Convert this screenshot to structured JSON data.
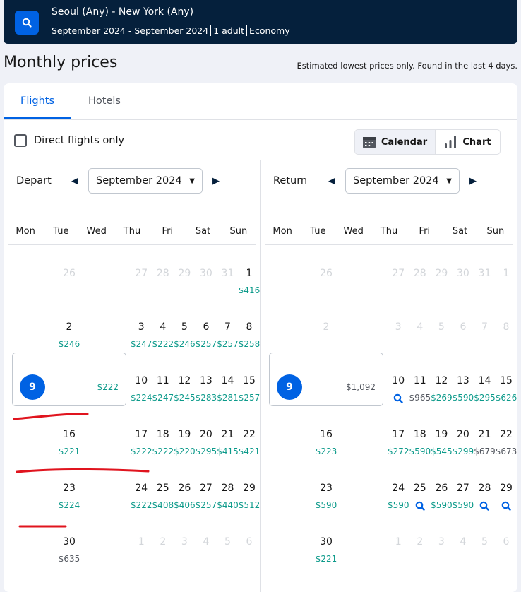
{
  "header": {
    "route": "Seoul (Any) - New York (Any)",
    "dates": "September 2024 - September 2024",
    "travellers": "1 adult",
    "cabin": "Economy"
  },
  "title": "Monthly prices",
  "note": "Estimated lowest prices only. Found in the last 4 days.",
  "tabs": [
    {
      "label": "Flights",
      "active": true
    },
    {
      "label": "Hotels",
      "active": false
    }
  ],
  "direct_label": "Direct flights only",
  "direct_checked": false,
  "view": {
    "calendar": "Calendar",
    "chart": "Chart",
    "active": "Calendar"
  },
  "weekdays": [
    "Mon",
    "Tue",
    "Wed",
    "Thu",
    "Fri",
    "Sat",
    "Sun"
  ],
  "colors": {
    "accent": "#0062e3",
    "header": "#05203c",
    "cheap": "#0c9a8a",
    "normal": "#545860",
    "annotation": "#e0141e"
  },
  "depart": {
    "label": "Depart",
    "month": "September 2024",
    "cells": [
      [
        "26",
        "",
        ""
      ],
      [
        "27",
        "",
        ""
      ],
      [
        "28",
        "",
        ""
      ],
      [
        "29",
        "",
        ""
      ],
      [
        "30",
        "",
        ""
      ],
      [
        "31",
        "",
        ""
      ],
      [
        "1",
        "$416",
        "g",
        1
      ],
      [
        "2",
        "$246",
        "g",
        1
      ],
      [
        "3",
        "$247",
        "g",
        1
      ],
      [
        "4",
        "$222",
        "g",
        1
      ],
      [
        "5",
        "$246",
        "g",
        1
      ],
      [
        "6",
        "$257",
        "g",
        1
      ],
      [
        "7",
        "$257",
        "g",
        1
      ],
      [
        "8",
        "$258",
        "g",
        1
      ],
      [
        "9",
        "$222",
        "g",
        2
      ],
      [
        "10",
        "$224",
        "g",
        1
      ],
      [
        "11",
        "$247",
        "g",
        1
      ],
      [
        "12",
        "$245",
        "g",
        1
      ],
      [
        "13",
        "$283",
        "g",
        1
      ],
      [
        "14",
        "$281",
        "g",
        1
      ],
      [
        "15",
        "$257",
        "g",
        1
      ],
      [
        "16",
        "$221",
        "g",
        1
      ],
      [
        "17",
        "$222",
        "g",
        1
      ],
      [
        "18",
        "$222",
        "g",
        1
      ],
      [
        "19",
        "$220",
        "g",
        1
      ],
      [
        "20",
        "$295",
        "g",
        1
      ],
      [
        "21",
        "$415",
        "g",
        1
      ],
      [
        "22",
        "$421",
        "g",
        1
      ],
      [
        "23",
        "$224",
        "g",
        1
      ],
      [
        "24",
        "$222",
        "g",
        1
      ],
      [
        "25",
        "$408",
        "g",
        1
      ],
      [
        "26",
        "$406",
        "g",
        1
      ],
      [
        "27",
        "$257",
        "g",
        1
      ],
      [
        "28",
        "$440",
        "g",
        1
      ],
      [
        "29",
        "$512",
        "g",
        1
      ],
      [
        "30",
        "$635",
        "n",
        1
      ],
      [
        "1",
        "",
        ""
      ],
      [
        "2",
        "",
        ""
      ],
      [
        "3",
        "",
        ""
      ],
      [
        "4",
        "",
        ""
      ],
      [
        "5",
        "",
        ""
      ],
      [
        "6",
        "",
        ""
      ]
    ]
  },
  "return": {
    "label": "Return",
    "month": "September 2024",
    "cells": [
      [
        "26",
        "",
        ""
      ],
      [
        "27",
        "",
        ""
      ],
      [
        "28",
        "",
        ""
      ],
      [
        "29",
        "",
        ""
      ],
      [
        "30",
        "",
        ""
      ],
      [
        "31",
        "",
        ""
      ],
      [
        "1",
        "",
        ""
      ],
      [
        "2",
        "",
        ""
      ],
      [
        "3",
        "",
        ""
      ],
      [
        "4",
        "",
        ""
      ],
      [
        "5",
        "",
        ""
      ],
      [
        "6",
        "",
        ""
      ],
      [
        "7",
        "",
        ""
      ],
      [
        "8",
        "",
        ""
      ],
      [
        "9",
        "$1,092",
        "n",
        2
      ],
      [
        "10",
        "",
        "s",
        1
      ],
      [
        "11",
        "$965",
        "n",
        1
      ],
      [
        "12",
        "$269",
        "g",
        1
      ],
      [
        "13",
        "$590",
        "g",
        1
      ],
      [
        "14",
        "$295",
        "g",
        1
      ],
      [
        "15",
        "$626",
        "g",
        1
      ],
      [
        "16",
        "$223",
        "g",
        1
      ],
      [
        "17",
        "$272",
        "g",
        1
      ],
      [
        "18",
        "$590",
        "g",
        1
      ],
      [
        "19",
        "$545",
        "g",
        1
      ],
      [
        "20",
        "$299",
        "g",
        1
      ],
      [
        "21",
        "$679",
        "n",
        1
      ],
      [
        "22",
        "$673",
        "n",
        1
      ],
      [
        "23",
        "$590",
        "g",
        1
      ],
      [
        "24",
        "$590",
        "g",
        1
      ],
      [
        "25",
        "",
        "s",
        1
      ],
      [
        "26",
        "$590",
        "g",
        1
      ],
      [
        "27",
        "$590",
        "g",
        1
      ],
      [
        "28",
        "",
        "s",
        1
      ],
      [
        "29",
        "",
        "s",
        1
      ],
      [
        "30",
        "$221",
        "g",
        1
      ],
      [
        "1",
        "",
        ""
      ],
      [
        "2",
        "",
        ""
      ],
      [
        "3",
        "",
        ""
      ],
      [
        "4",
        "",
        ""
      ],
      [
        "5",
        "",
        ""
      ],
      [
        "6",
        "",
        ""
      ]
    ]
  }
}
